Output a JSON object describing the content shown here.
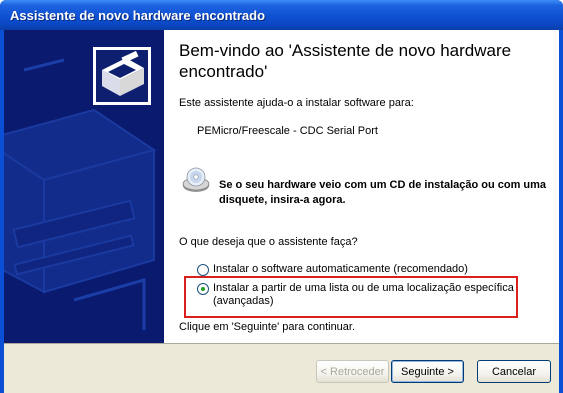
{
  "window": {
    "title": "Assistente de novo hardware encontrado"
  },
  "content": {
    "heading": "Bem-vindo ao 'Assistente de novo hardware encontrado'",
    "intro": "Este assistente ajuda-o a instalar software para:",
    "device_name": "PEMicro/Freescale - CDC Serial Port",
    "cd_prompt": "Se o seu hardware veio com um CD de instalação ou com uma disquete, insira-a agora.",
    "question": "O que deseja que o assistente faça?",
    "options": [
      {
        "label": "Instalar o software automaticamente (recomendado)",
        "selected": false
      },
      {
        "label": "Instalar a partir de uma lista ou de uma localização específica (avançadas)",
        "selected": true
      }
    ],
    "continue_hint": "Clique em 'Seguinte' para continuar."
  },
  "buttons": {
    "back": "< Retroceder",
    "next": "Seguinte >",
    "cancel": "Cancelar"
  },
  "colors": {
    "titlebar": "#0b48c4",
    "banner": "#0a1a6e",
    "highlight": "#d9201c"
  }
}
